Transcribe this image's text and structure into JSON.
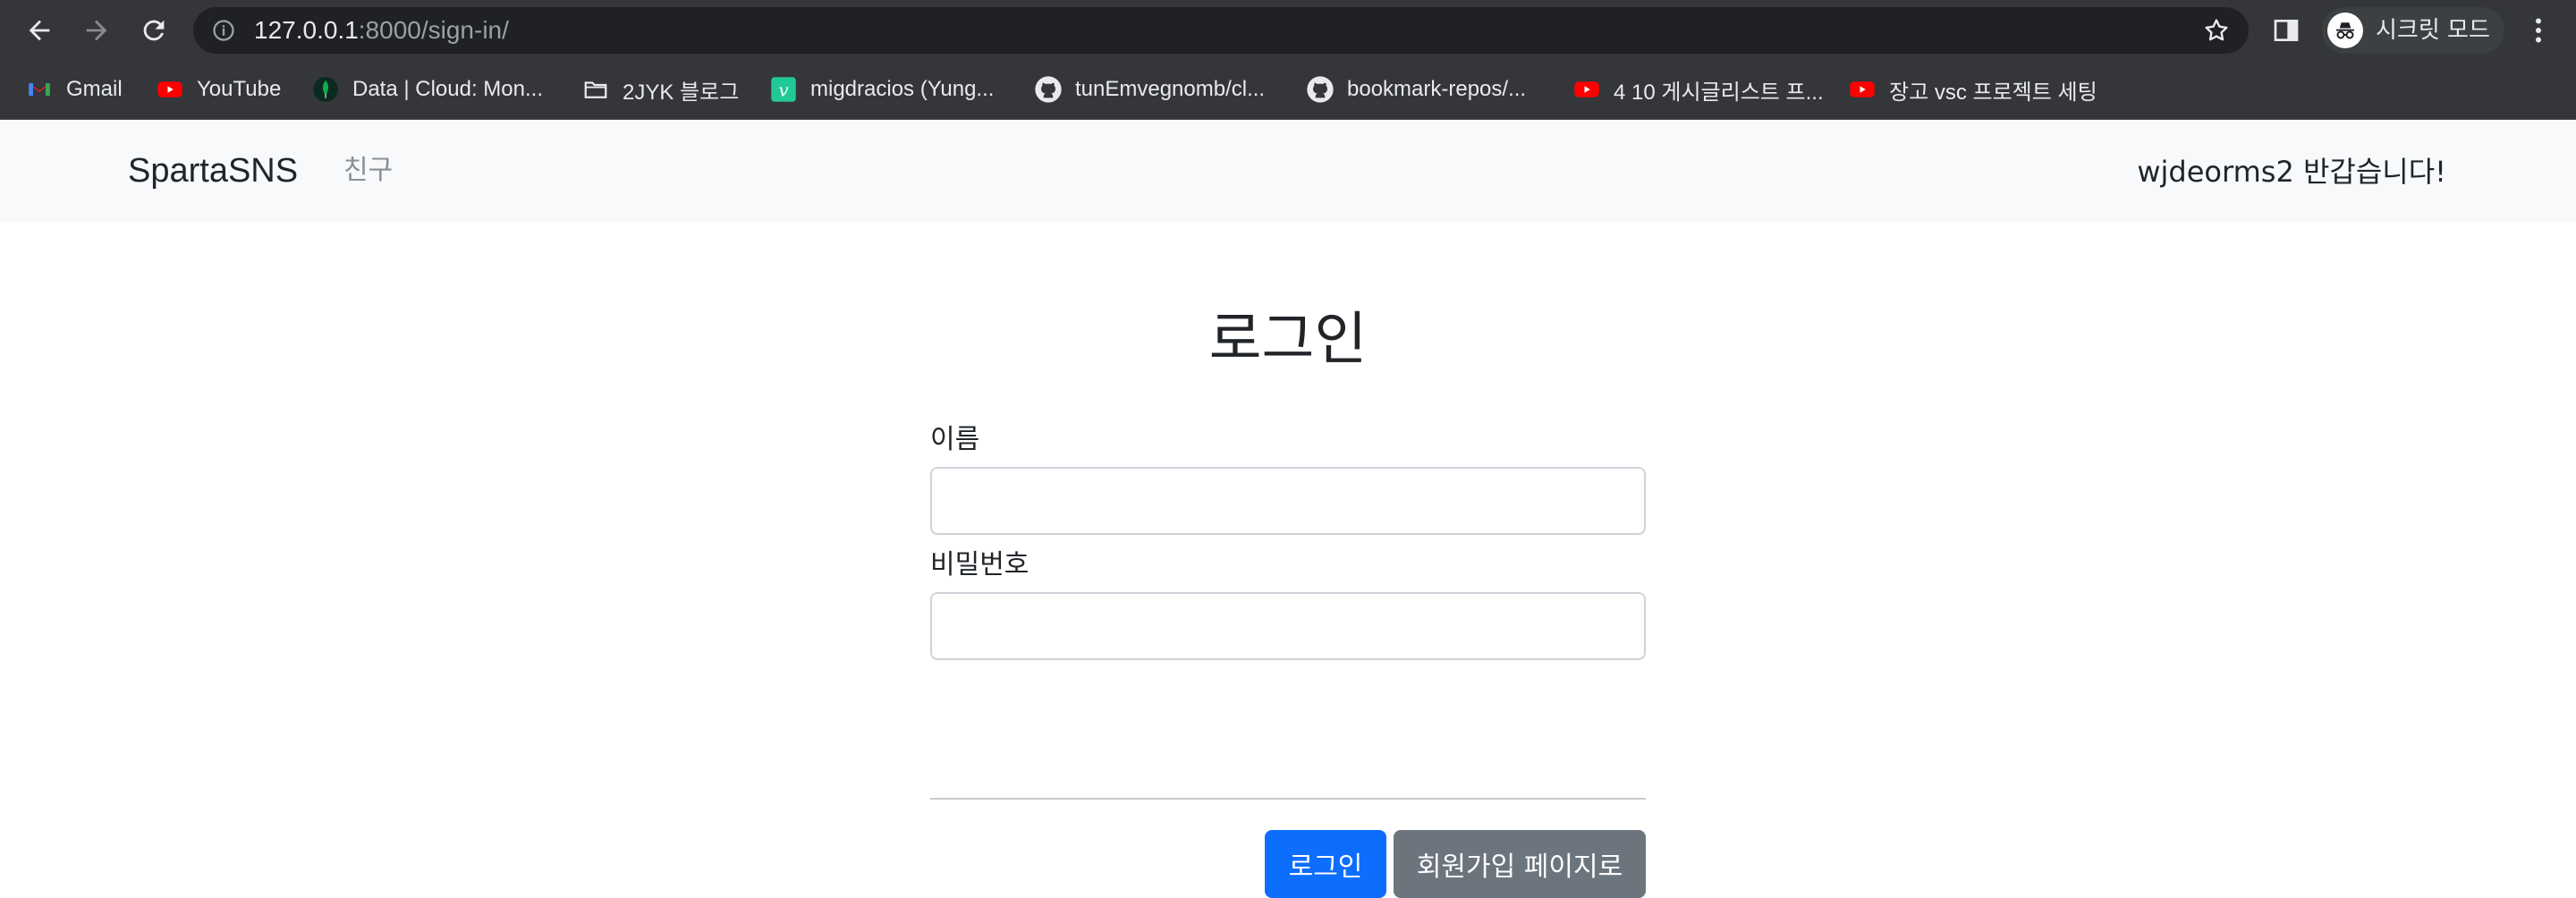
{
  "browser": {
    "url_host": "127.0.0.1",
    "url_rest": ":8000/sign-in/",
    "profile_label": "시크릿 모드",
    "bookmarks": [
      {
        "label": "Gmail",
        "icon": "gmail-icon"
      },
      {
        "label": "YouTube",
        "icon": "youtube-icon"
      },
      {
        "label": "Data | Cloud: Mon...",
        "icon": "mongodb-leaf-icon"
      },
      {
        "label": "2JYK 블로그",
        "icon": "folder-icon"
      },
      {
        "label": "migdracios (Yung...",
        "icon": "velog-icon"
      },
      {
        "label": "tunEmvegnomb/cl...",
        "icon": "github-icon"
      },
      {
        "label": "bookmark-repos/...",
        "icon": "github-icon"
      },
      {
        "label": "4 10 게시글리스트 프...",
        "icon": "youtube-icon"
      },
      {
        "label": "장고 vsc 프로젝트 세팅",
        "icon": "youtube-icon"
      }
    ],
    "colors": {
      "chrome_bg": "#35363a",
      "omnibox_bg": "#202124",
      "youtube_red": "#ff0000"
    }
  },
  "navbar": {
    "brand": "SpartaSNS",
    "link_friends": "친구",
    "greeting": "wjdeorms2 반갑습니다!"
  },
  "login": {
    "title": "로그인",
    "username_label": "이름",
    "password_label": "비밀번호",
    "username_value": "",
    "password_value": "",
    "login_button": "로그인",
    "signup_button": "회원가입 페이지로"
  },
  "colors": {
    "primary": "#0d6efd",
    "secondary": "#6c757d",
    "navbar_bg": "#f8f9fa"
  }
}
